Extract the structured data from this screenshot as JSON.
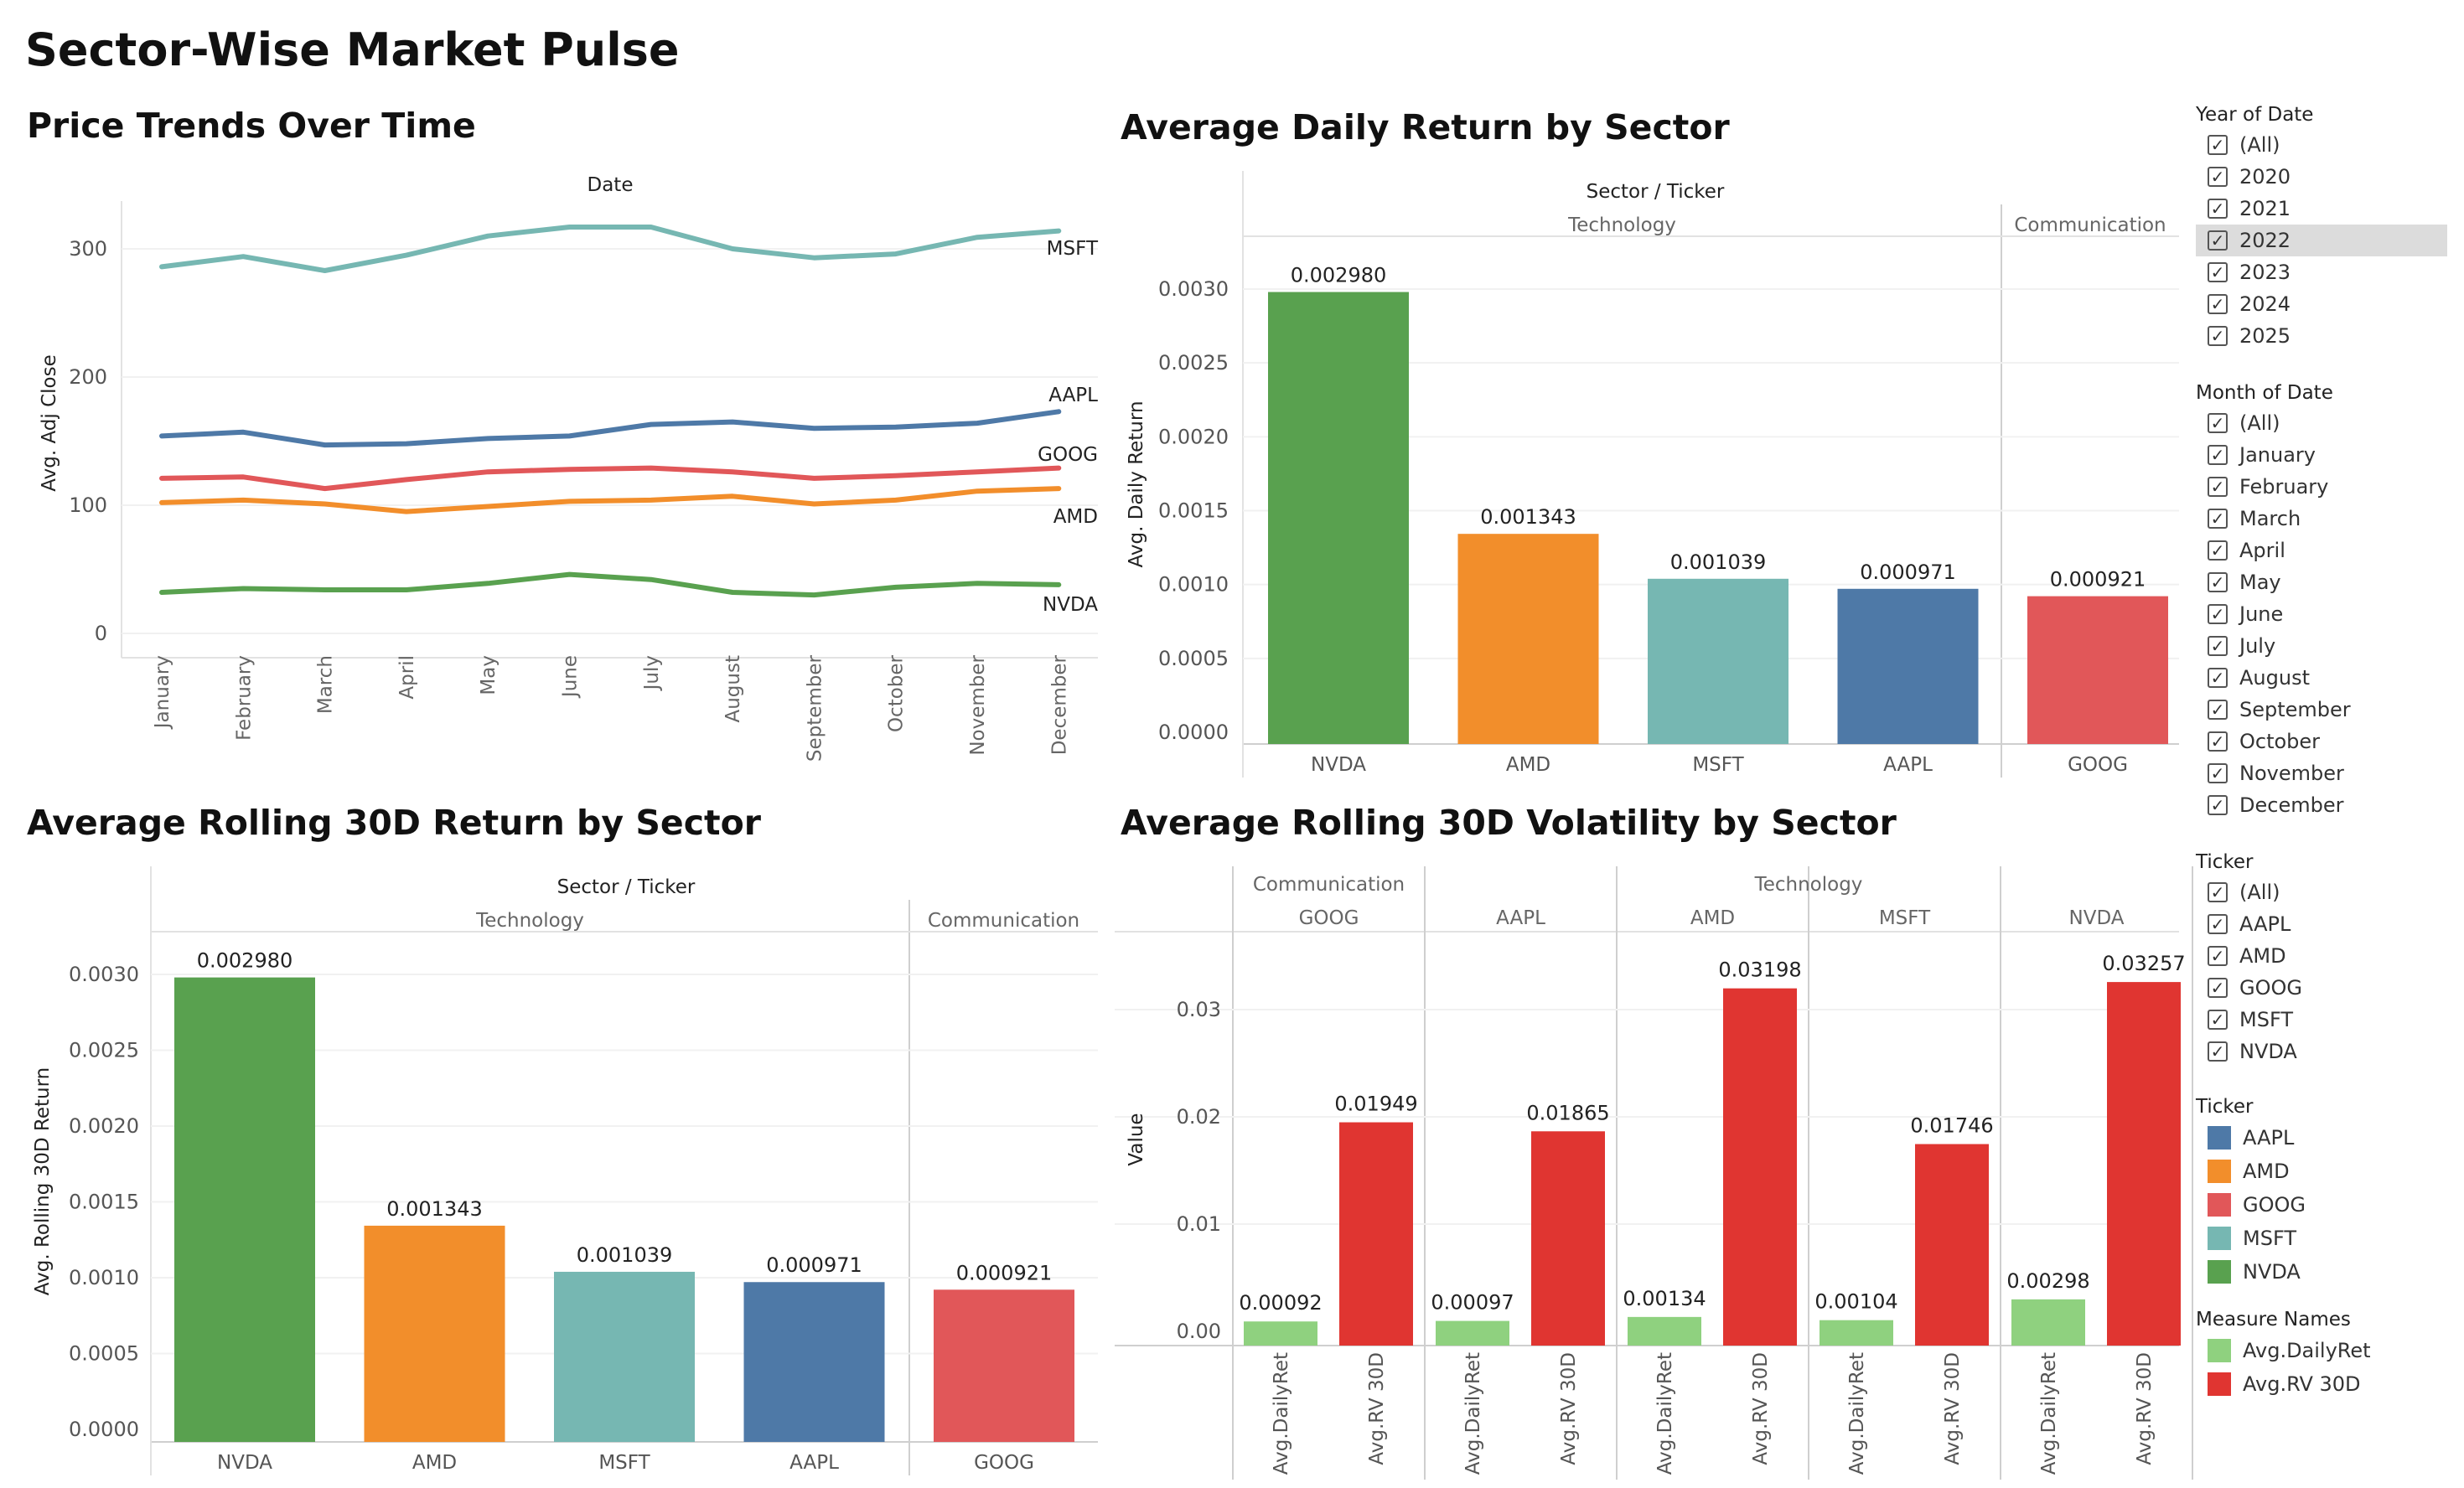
{
  "page_title": "Sector-Wise Market Pulse",
  "panels": {
    "price": {
      "title": "Price Trends Over Time"
    },
    "daily": {
      "title": "Average Daily Return by Sector"
    },
    "rolling": {
      "title": "Average Rolling 30D Return by Sector"
    },
    "vol": {
      "title": "Average Rolling 30D Volatility by Sector"
    }
  },
  "colors": {
    "AAPL": "#4e79a7",
    "AMD": "#f28e2b",
    "GOOG": "#e15759",
    "MSFT": "#76b7b2",
    "NVDA": "#59a14f",
    "Avg.DailyRet": "#8fd17f",
    "Avg.RV 30D": "#e03531"
  },
  "sidebar": {
    "year_filter": {
      "heading": "Year of Date",
      "items": [
        "(All)",
        "2020",
        "2021",
        "2022",
        "2023",
        "2024",
        "2025"
      ],
      "highlighted": "2022"
    },
    "month_filter": {
      "heading": "Month of Date",
      "items": [
        "(All)",
        "January",
        "February",
        "March",
        "April",
        "May",
        "June",
        "July",
        "August",
        "September",
        "October",
        "November",
        "December"
      ]
    },
    "ticker_filter": {
      "heading": "Ticker",
      "items": [
        "(All)",
        "AAPL",
        "AMD",
        "GOOG",
        "MSFT",
        "NVDA"
      ]
    },
    "ticker_legend": {
      "heading": "Ticker",
      "items": [
        "AAPL",
        "AMD",
        "GOOG",
        "MSFT",
        "NVDA"
      ]
    },
    "measure_legend": {
      "heading": "Measure Names",
      "items": [
        "Avg.DailyRet",
        "Avg.RV 30D"
      ]
    }
  },
  "chart_data": [
    {
      "id": "price",
      "type": "line",
      "title": "Price Trends Over Time",
      "xlabel_top": "Date",
      "ylabel": "Avg. Adj Close",
      "x": [
        "January",
        "February",
        "March",
        "April",
        "May",
        "June",
        "July",
        "August",
        "September",
        "October",
        "November",
        "December"
      ],
      "ylim": [
        0,
        330
      ],
      "yticks": [
        0,
        100,
        200,
        300
      ],
      "series": [
        {
          "name": "MSFT",
          "values": [
            286,
            294,
            283,
            295,
            310,
            317,
            317,
            300,
            293,
            296,
            309,
            314
          ]
        },
        {
          "name": "AAPL",
          "values": [
            154,
            157,
            147,
            148,
            152,
            154,
            163,
            165,
            160,
            161,
            164,
            173
          ]
        },
        {
          "name": "GOOG",
          "values": [
            121,
            122,
            113,
            120,
            126,
            128,
            129,
            126,
            121,
            123,
            126,
            129
          ]
        },
        {
          "name": "AMD",
          "values": [
            102,
            104,
            101,
            95,
            99,
            103,
            104,
            107,
            101,
            104,
            111,
            113
          ]
        },
        {
          "name": "NVDA",
          "values": [
            32,
            35,
            34,
            34,
            39,
            46,
            42,
            32,
            30,
            36,
            39,
            38
          ]
        }
      ]
    },
    {
      "id": "daily",
      "type": "bar",
      "title": "Average Daily Return by Sector",
      "header": "Sector / Ticker",
      "groups": [
        {
          "name": "Technology",
          "tickers": [
            "NVDA",
            "AMD",
            "MSFT",
            "AAPL"
          ]
        },
        {
          "name": "Communication",
          "tickers": [
            "GOOG"
          ]
        }
      ],
      "values": [
        0.00298,
        0.001343,
        0.001039,
        0.000971,
        0.000921
      ],
      "labels": [
        "0.002980",
        "0.001343",
        "0.001039",
        "0.000971",
        "0.000921"
      ],
      "ylabel": "Avg. Daily Return",
      "ylim": [
        0,
        0.0031
      ],
      "yticks": [
        "0.0000",
        "0.0005",
        "0.0010",
        "0.0015",
        "0.0020",
        "0.0025",
        "0.0030"
      ]
    },
    {
      "id": "rolling",
      "type": "bar",
      "title": "Average Rolling 30D Return by Sector",
      "header": "Sector / Ticker",
      "groups": [
        {
          "name": "Technology",
          "tickers": [
            "NVDA",
            "AMD",
            "MSFT",
            "AAPL"
          ]
        },
        {
          "name": "Communication",
          "tickers": [
            "GOOG"
          ]
        }
      ],
      "values": [
        0.00298,
        0.001343,
        0.001039,
        0.000971,
        0.000921
      ],
      "labels": [
        "0.002980",
        "0.001343",
        "0.001039",
        "0.000971",
        "0.000921"
      ],
      "ylabel": "Avg. Rolling 30D Return",
      "ylim": [
        0,
        0.0031
      ],
      "yticks": [
        "0.0000",
        "0.0005",
        "0.0010",
        "0.0015",
        "0.0020",
        "0.0025",
        "0.0030"
      ]
    },
    {
      "id": "vol",
      "type": "bar",
      "title": "Average Rolling 30D Volatility by Sector",
      "sectors": [
        {
          "name": "Communication",
          "tickers": [
            "GOOG"
          ]
        },
        {
          "name": "Technology",
          "tickers": [
            "AAPL",
            "AMD",
            "MSFT",
            "NVDA"
          ]
        }
      ],
      "measures": [
        "Avg.DailyRet",
        "Avg.RV 30D"
      ],
      "ylabel": "Value",
      "ylim": [
        0,
        0.0355
      ],
      "yticks": [
        "0.00",
        "0.01",
        "0.02",
        "0.03"
      ],
      "series": [
        {
          "name": "Avg.DailyRet",
          "values": [
            0.00092,
            0.00097,
            0.00134,
            0.00104,
            0.00298
          ],
          "labels": [
            "0.00092",
            "0.00097",
            "0.00134",
            "0.00104",
            "0.00298"
          ]
        },
        {
          "name": "Avg.RV 30D",
          "values": [
            0.01949,
            0.01865,
            0.03198,
            0.01746,
            0.03257
          ],
          "labels": [
            "0.01949",
            "0.01865",
            "0.03198",
            "0.01746",
            "0.03257"
          ]
        }
      ]
    }
  ]
}
